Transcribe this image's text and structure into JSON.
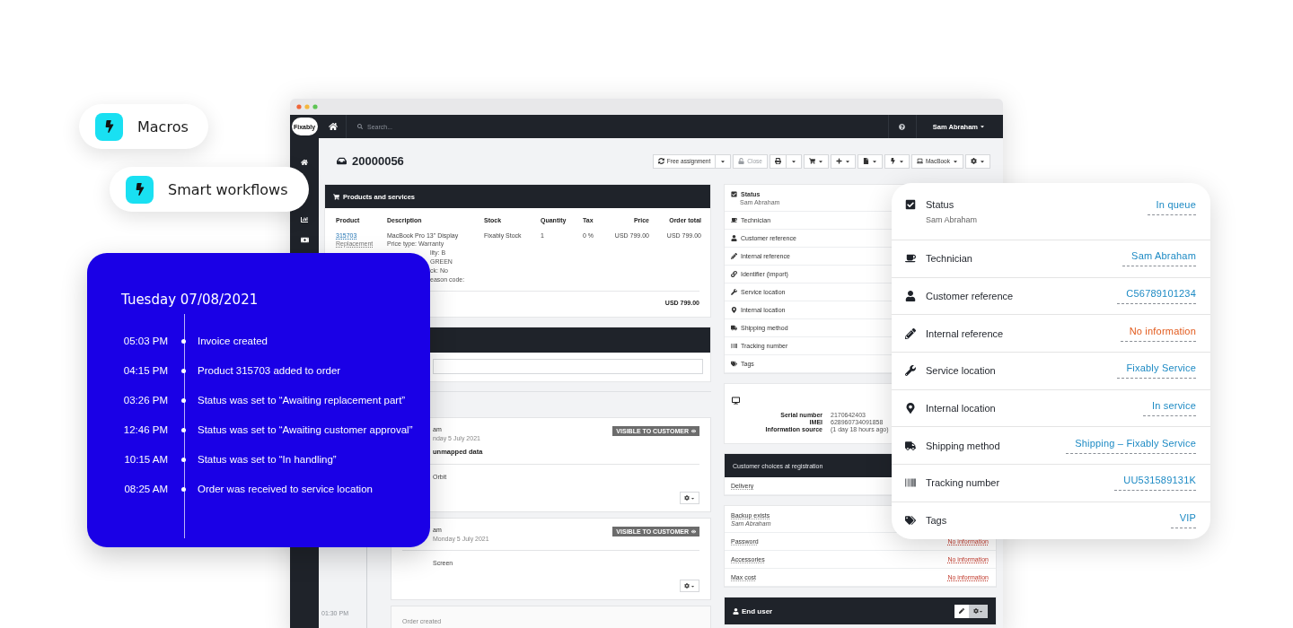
{
  "floating_buttons": [
    {
      "label": "Macros"
    },
    {
      "label": "Smart workflows"
    }
  ],
  "app": {
    "logo": "Fixably",
    "search": {
      "placeholder": "Search..."
    },
    "user": "Sam Abraham",
    "order_number": "20000056",
    "toolbar": [
      {
        "kind": "split",
        "label": "Free assignment",
        "disabled": false
      },
      {
        "kind": "plain",
        "label": "Close",
        "disabled": true
      },
      {
        "kind": "split",
        "disabled": false
      },
      {
        "kind": "menu",
        "disabled": false
      },
      {
        "kind": "menu",
        "disabled": false
      },
      {
        "kind": "menu",
        "disabled": false
      },
      {
        "kind": "menu",
        "disabled": false
      },
      {
        "kind": "menu",
        "label": "MacBook",
        "disabled": false
      },
      {
        "kind": "menu",
        "disabled": false
      }
    ],
    "products": {
      "title": "Products and services",
      "columns": [
        "Product",
        "Description",
        "Stock",
        "Quantity",
        "Tax",
        "Price",
        "Order total"
      ],
      "rows": [
        {
          "product": "315703",
          "product_type": "Replacement",
          "description": "MacBook Pro 13\" Display",
          "details": [
            "Price type: Warranty"
          ],
          "details_partial": [
            "lity: B",
            "GREEN",
            "ck: No",
            "eason code:"
          ],
          "stock": "Fixably Stock",
          "quantity": "1",
          "tax": "0 %",
          "price": "USD 799.00",
          "total": "USD 799.00"
        }
      ],
      "total": "USD 799.00"
    },
    "notes": [
      {
        "author": "am",
        "date": "nday 5 July 2021",
        "title": "unmapped data",
        "body": "Orbit",
        "badge": "VISIBLE TO CUSTOMER"
      },
      {
        "author": "am",
        "date": "Monday 5 July 2021",
        "body": "Screen",
        "badge": "VISIBLE TO CUSTOMER"
      }
    ],
    "last_event": {
      "time": "01:30 PM",
      "text": "Order created"
    },
    "info": [
      {
        "kind": "title",
        "label": "Status",
        "sub": "Sam Abraham"
      },
      {
        "kind": "field",
        "label": "Technician"
      },
      {
        "kind": "field",
        "label": "Customer reference"
      },
      {
        "kind": "field",
        "label": "Internal reference"
      },
      {
        "kind": "field",
        "label": "Identifier (import)"
      },
      {
        "kind": "field",
        "label": "Service location"
      },
      {
        "kind": "field",
        "label": "Internal location"
      },
      {
        "kind": "field",
        "label": "Shipping method"
      },
      {
        "kind": "field",
        "label": "Tracking number"
      },
      {
        "kind": "field",
        "label": "Tags"
      }
    ],
    "device": [
      {
        "label": "Serial number",
        "value": "2170642403"
      },
      {
        "label": "IMEI",
        "value": "628960734091858"
      },
      {
        "label": "Information source",
        "value": "(1 day 18 hours ago)"
      }
    ],
    "customer_choices": {
      "title": "Customer choices at registration",
      "rows": [
        "Delivery"
      ]
    },
    "extras": [
      {
        "label": "Backup exists",
        "sub": "Sam Abraham"
      },
      {
        "label": "Password",
        "value": "No information"
      },
      {
        "label": "Accessories",
        "value": "No information"
      },
      {
        "label": "Max cost",
        "value": "No information"
      }
    ],
    "end_user": {
      "title": "End user"
    }
  },
  "timeline_card": {
    "date": "Tuesday 07/08/2021",
    "events": [
      {
        "time": "05:03 PM",
        "text": "Invoice created"
      },
      {
        "time": "04:15 PM",
        "text": "Product 315703 added to order"
      },
      {
        "time": "03:26 PM",
        "text": "Status was set to “Awaiting replacement part”"
      },
      {
        "time": "12:46 PM",
        "text": "Status was set to “Awaiting customer approval”"
      },
      {
        "time": "10:15 AM",
        "text": "Status was set to “In handling”"
      },
      {
        "time": "08:25 AM",
        "text": "Order was received to service location"
      }
    ]
  },
  "detail_card": {
    "rows": [
      {
        "label": "Status",
        "sub": "Sam Abraham",
        "value": "In queue",
        "missing": false
      },
      {
        "label": "Technician",
        "value": "Sam Abraham",
        "missing": false
      },
      {
        "label": "Customer reference",
        "value": "C56789101234",
        "missing": false
      },
      {
        "label": "Internal reference",
        "value": "No information",
        "missing": true
      },
      {
        "label": "Service location",
        "value": "Fixably Service",
        "missing": false
      },
      {
        "label": "Internal location",
        "value": "In service",
        "missing": false
      },
      {
        "label": "Shipping method",
        "value": "Shipping – Fixably Service",
        "missing": false
      },
      {
        "label": "Tracking number",
        "value": "UU531589131K",
        "missing": false
      },
      {
        "label": "Tags",
        "value": "VIP",
        "missing": false
      }
    ]
  }
}
